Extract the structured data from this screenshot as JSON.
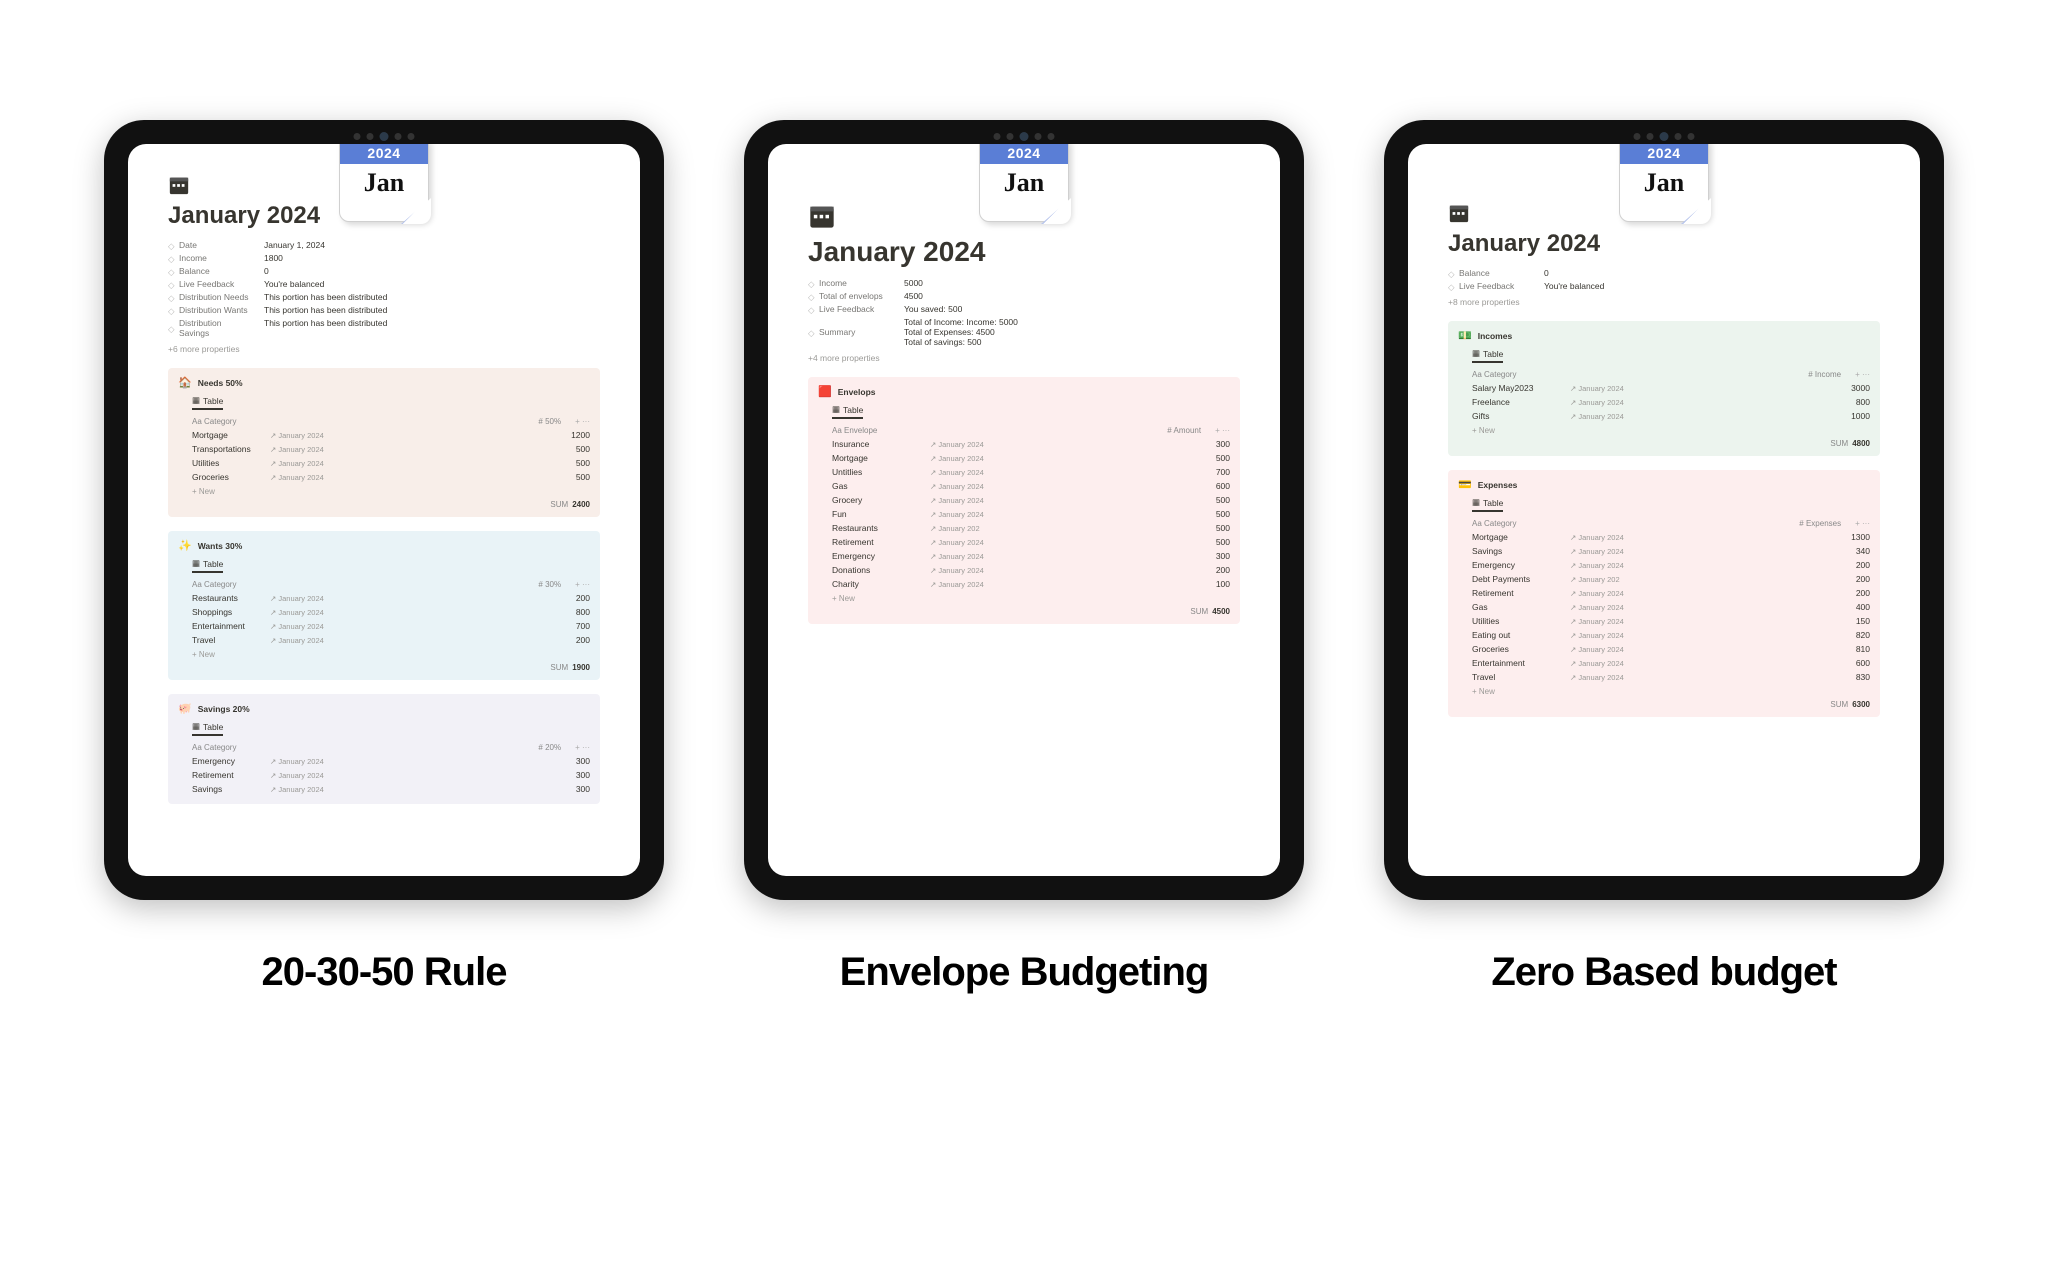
{
  "calendar_badge": {
    "year": "2024",
    "month": "Jan"
  },
  "more_props_label": "+6 more properties",
  "more_props_label_b": "+4 more properties",
  "more_props_label_c": "+8 more properties",
  "table_view_label": "Table",
  "new_row_label": "+ New",
  "col_category": "Aa Category",
  "col_envelope": "Aa Envelope",
  "col_amount": "# Amount",
  "sum_label": "SUM",
  "tablet1": {
    "title": "January 2024",
    "props": [
      {
        "k": "Date",
        "v": "January 1, 2024"
      },
      {
        "k": "Income",
        "v": "1800"
      },
      {
        "k": "Balance",
        "v": "0"
      },
      {
        "k": "Live Feedback",
        "v": "You're balanced"
      },
      {
        "k": "Distribution Needs",
        "v": "This portion has been distributed"
      },
      {
        "k": "Distribution Wants",
        "v": "This portion has been distributed"
      },
      {
        "k": "Distribution Savings",
        "v": "This portion has been distributed"
      }
    ],
    "needs": {
      "heading": "Needs 50%",
      "pct_col": "# 50%",
      "rows": [
        [
          "Mortgage",
          "January 2024",
          "1200"
        ],
        [
          "Transportations",
          "January 2024",
          "500"
        ],
        [
          "Utilities",
          "January 2024",
          "500"
        ],
        [
          "Groceries",
          "January 2024",
          "500"
        ]
      ],
      "sum": "2400"
    },
    "wants": {
      "heading": "Wants 30%",
      "pct_col": "# 30%",
      "rows": [
        [
          "Restaurants",
          "January 2024",
          "200"
        ],
        [
          "Shoppings",
          "January 2024",
          "800"
        ],
        [
          "Entertainment",
          "January 2024",
          "700"
        ],
        [
          "Travel",
          "January 2024",
          "200"
        ]
      ],
      "sum": "1900"
    },
    "savings": {
      "heading": "Savings 20%",
      "pct_col": "# 20%",
      "rows": [
        [
          "Emergency",
          "January 2024",
          "300"
        ],
        [
          "Retirement",
          "January 2024",
          "300"
        ],
        [
          "Savings",
          "January 2024",
          "300"
        ]
      ]
    },
    "caption": "20-30-50 Rule"
  },
  "tablet2": {
    "title": "January 2024",
    "props": [
      {
        "k": "Income",
        "v": "5000"
      },
      {
        "k": "Total of envelops",
        "v": "4500"
      },
      {
        "k": "Live Feedback",
        "v": "You saved: 500"
      },
      {
        "k": "Summary",
        "v": "Total of Income: Income: 5000\nTotal of Expenses: 4500\nTotal of savings: 500"
      }
    ],
    "env": {
      "heading": "Envelops",
      "rows": [
        [
          "Insurance",
          "January 2024",
          "300"
        ],
        [
          "Mortgage",
          "January 2024",
          "500"
        ],
        [
          "Untitlies",
          "January 2024",
          "700"
        ],
        [
          "Gas",
          "January 2024",
          "600"
        ],
        [
          "Grocery",
          "January 2024",
          "500"
        ],
        [
          "Fun",
          "January 2024",
          "500"
        ],
        [
          "Restaurants",
          "January 202",
          "500"
        ],
        [
          "Retirement",
          "January 2024",
          "500"
        ],
        [
          "Emergency",
          "January 2024",
          "300"
        ],
        [
          "Donations",
          "January 2024",
          "200"
        ],
        [
          "Charity",
          "January 2024",
          "100"
        ]
      ],
      "sum": "4500"
    },
    "caption": "Envelope Budgeting"
  },
  "tablet3": {
    "title": "January 2024",
    "props": [
      {
        "k": "Balance",
        "v": "0"
      },
      {
        "k": "Live Feedback",
        "v": "You're balanced"
      }
    ],
    "incomes": {
      "heading": "Incomes",
      "col_right": "# Income",
      "rows": [
        [
          "Salary May2023",
          "January 2024",
          "3000"
        ],
        [
          "Freelance",
          "January 2024",
          "800"
        ],
        [
          "Gifts",
          "January 2024",
          "1000"
        ]
      ],
      "sum": "4800"
    },
    "expenses": {
      "heading": "Expenses",
      "col_right": "# Expenses",
      "rows": [
        [
          "Mortgage",
          "January 2024",
          "1300"
        ],
        [
          "Savings",
          "January 2024",
          "340"
        ],
        [
          "Emergency",
          "January 2024",
          "200"
        ],
        [
          "Debt Payments",
          "January 202",
          "200"
        ],
        [
          "Retirement",
          "January 2024",
          "200"
        ],
        [
          "Gas",
          "January 2024",
          "400"
        ],
        [
          "Utilities",
          "January 2024",
          "150"
        ],
        [
          "Eating out",
          "January 2024",
          "820"
        ],
        [
          "Groceries",
          "January 2024",
          "810"
        ],
        [
          "Entertainment",
          "January 2024",
          "600"
        ],
        [
          "Travel",
          "January 2024",
          "830"
        ]
      ],
      "sum": "6300"
    },
    "caption": "Zero Based budget"
  }
}
